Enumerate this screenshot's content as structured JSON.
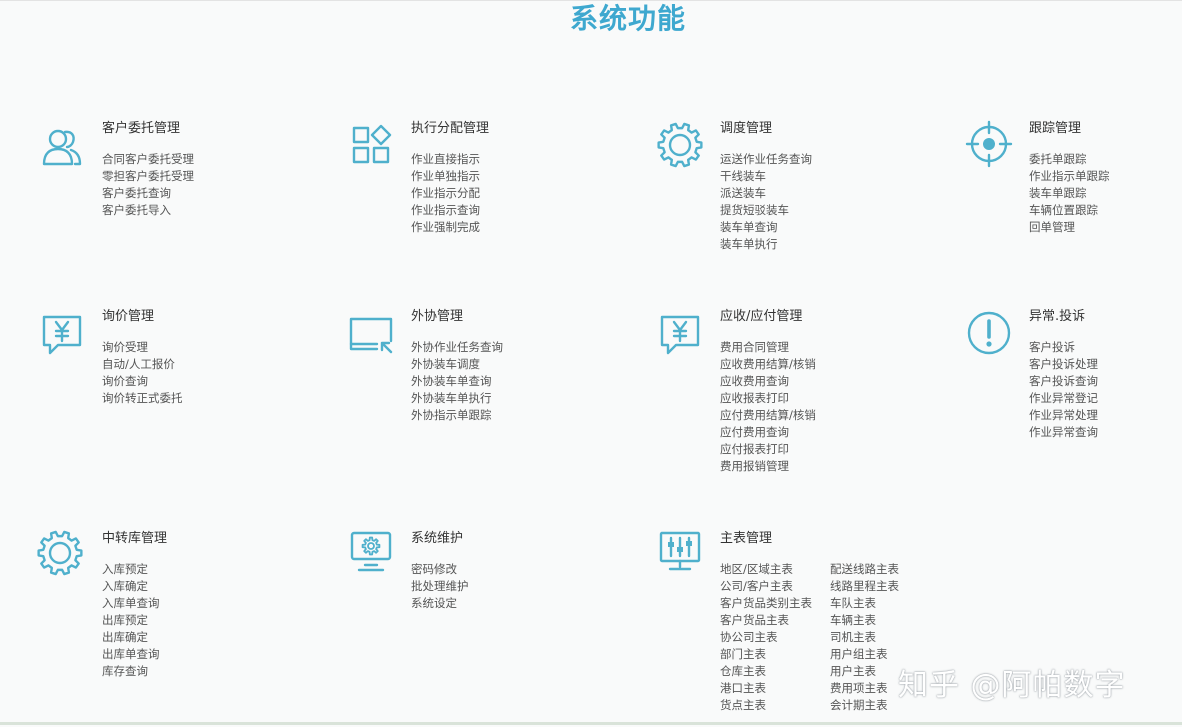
{
  "title": "系统功能",
  "watermark": "知乎 @阿帕数字",
  "modules": [
    {
      "title": "客户委托管理",
      "icon": "user-group-icon",
      "items": [
        "合同客户委托受理",
        "零担客户委托受理",
        "客户委托查询",
        "客户委托导入"
      ]
    },
    {
      "title": "执行分配管理",
      "icon": "grid-apps-icon",
      "items": [
        "作业直接指示",
        "作业单独指示",
        "作业指示分配",
        "作业指示查询",
        "作业强制完成"
      ]
    },
    {
      "title": "调度管理",
      "icon": "gear-icon",
      "items": [
        "运送作业任务查询",
        "干线装车",
        "派送装车",
        "提货短驳装车",
        "装车单查询",
        "装车单执行"
      ]
    },
    {
      "title": "跟踪管理",
      "icon": "target-icon",
      "items": [
        "委托单跟踪",
        "作业指示单跟踪",
        "装车单跟踪",
        "车辆位置跟踪",
        "回单管理"
      ]
    },
    {
      "title": "询价管理",
      "icon": "yen-chat-icon",
      "items": [
        "询价受理",
        "自动/人工报价",
        "询价查询",
        "询价转正式委托"
      ]
    },
    {
      "title": "外协管理",
      "icon": "monitor-arrow-icon",
      "items": [
        "外协作业任务查询",
        "外协装车调度",
        "外协装车单查询",
        "外协装车单执行",
        "外协指示单跟踪"
      ]
    },
    {
      "title": "应收/应付管理",
      "icon": "yen-chat-icon",
      "items": [
        "费用合同管理",
        "应收费用结算/核销",
        "应收费用查询",
        "应收报表打印",
        "应付费用结算/核销",
        "应付费用查询",
        "应付报表打印",
        "费用报销管理"
      ]
    },
    {
      "title": "异常.投诉",
      "icon": "exclamation-icon",
      "items": [
        "客户投诉",
        "客户投诉处理",
        "客户投诉查询",
        "作业异常登记",
        "作业异常处理",
        "作业异常查询"
      ]
    },
    {
      "title": "中转库管理",
      "icon": "gear-icon",
      "items": [
        "入库预定",
        "入库确定",
        "入库单查询",
        "出库预定",
        "出库确定",
        "出库单查询",
        "库存查询"
      ]
    },
    {
      "title": "系统维护",
      "icon": "monitor-gear-icon",
      "items": [
        "密码修改",
        "批处理维护",
        "系统设定"
      ]
    },
    {
      "title": "主表管理",
      "icon": "monitor-sliders-icon",
      "items": [
        "地区/区域主表",
        "公司/客户主表",
        "客户货品类别主表",
        "客户货品主表",
        "协公司主表",
        "部门主表",
        "仓库主表",
        "港口主表",
        "货点主表"
      ],
      "items2": [
        "配送线路主表",
        "线路里程主表",
        "车队主表",
        "车辆主表",
        "司机主表",
        "用户组主表",
        "用户主表",
        "费用项主表",
        "会计期主表"
      ]
    }
  ],
  "colors": {
    "accent": "#3ea8cf",
    "icon": "#4fb0cc"
  }
}
